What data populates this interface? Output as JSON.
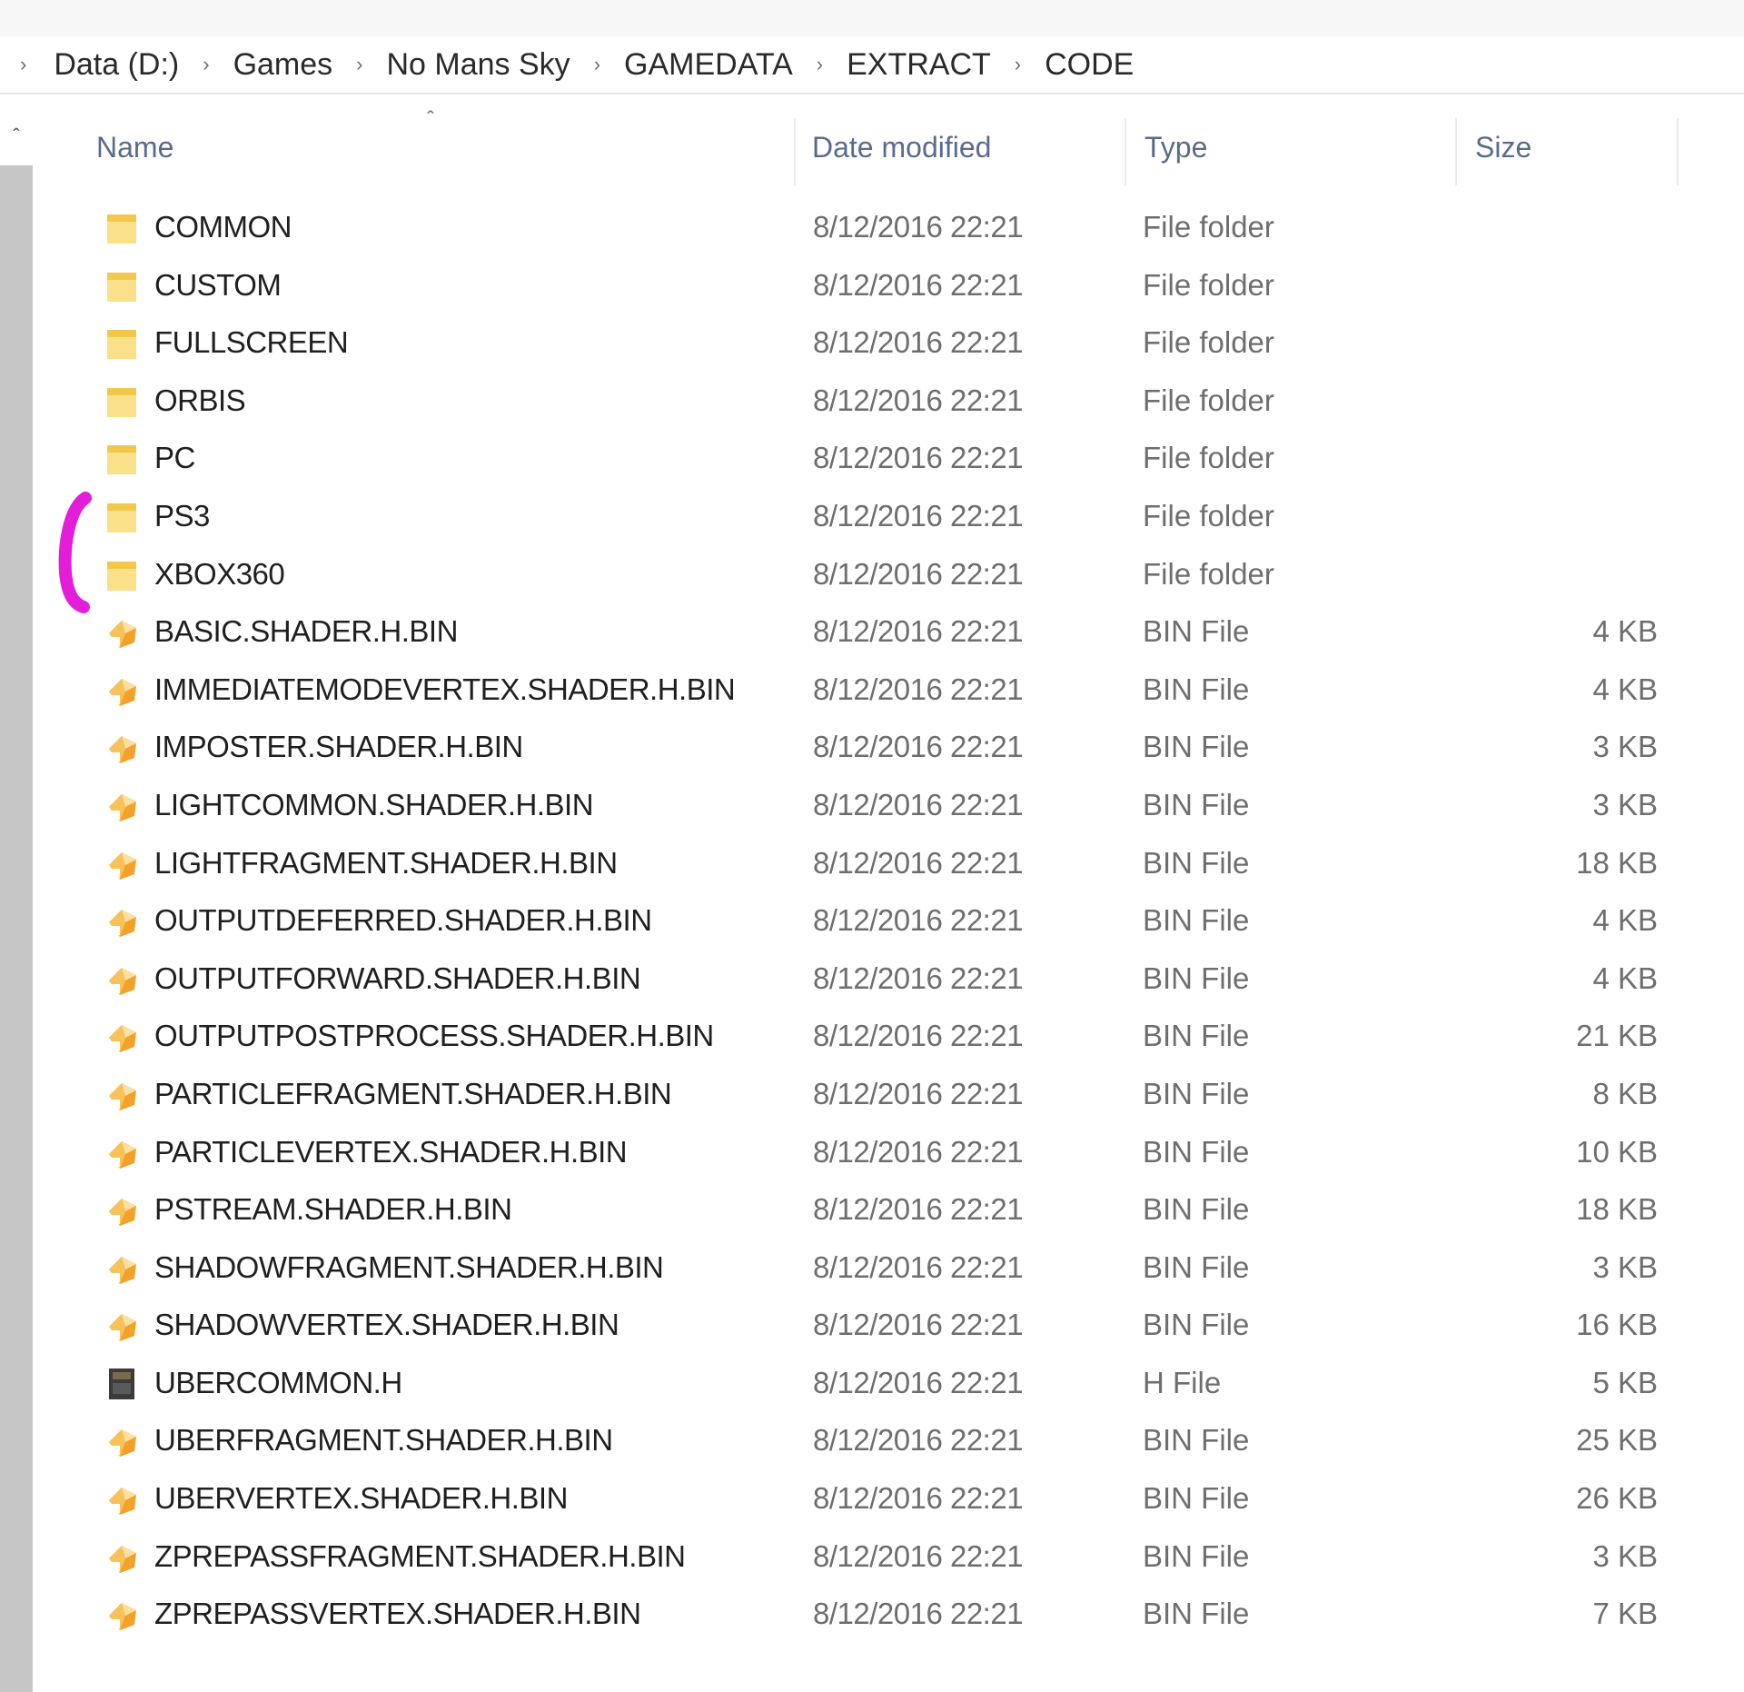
{
  "breadcrumb": {
    "items": [
      "Data (D:)",
      "Games",
      "No Mans Sky",
      "GAMEDATA",
      "EXTRACT",
      "CODE"
    ]
  },
  "columns": {
    "name": "Name",
    "date": "Date modified",
    "type": "Type",
    "size": "Size"
  },
  "icons": {
    "folder": "folder-icon",
    "bin": "bin-file-icon",
    "h": "h-file-icon"
  },
  "colors": {
    "folder": "#f7d66b",
    "bin": "#f2a12a",
    "annotation": "#e21ed8"
  },
  "files": [
    {
      "name": "COMMON",
      "date": "8/12/2016 22:21",
      "type": "File folder",
      "size": "",
      "icon": "folder"
    },
    {
      "name": "CUSTOM",
      "date": "8/12/2016 22:21",
      "type": "File folder",
      "size": "",
      "icon": "folder"
    },
    {
      "name": "FULLSCREEN",
      "date": "8/12/2016 22:21",
      "type": "File folder",
      "size": "",
      "icon": "folder"
    },
    {
      "name": "ORBIS",
      "date": "8/12/2016 22:21",
      "type": "File folder",
      "size": "",
      "icon": "folder"
    },
    {
      "name": "PC",
      "date": "8/12/2016 22:21",
      "type": "File folder",
      "size": "",
      "icon": "folder"
    },
    {
      "name": "PS3",
      "date": "8/12/2016 22:21",
      "type": "File folder",
      "size": "",
      "icon": "folder"
    },
    {
      "name": "XBOX360",
      "date": "8/12/2016 22:21",
      "type": "File folder",
      "size": "",
      "icon": "folder"
    },
    {
      "name": "BASIC.SHADER.H.BIN",
      "date": "8/12/2016 22:21",
      "type": "BIN File",
      "size": "4 KB",
      "icon": "bin"
    },
    {
      "name": "IMMEDIATEMODEVERTEX.SHADER.H.BIN",
      "date": "8/12/2016 22:21",
      "type": "BIN File",
      "size": "4 KB",
      "icon": "bin"
    },
    {
      "name": "IMPOSTER.SHADER.H.BIN",
      "date": "8/12/2016 22:21",
      "type": "BIN File",
      "size": "3 KB",
      "icon": "bin"
    },
    {
      "name": "LIGHTCOMMON.SHADER.H.BIN",
      "date": "8/12/2016 22:21",
      "type": "BIN File",
      "size": "3 KB",
      "icon": "bin"
    },
    {
      "name": "LIGHTFRAGMENT.SHADER.H.BIN",
      "date": "8/12/2016 22:21",
      "type": "BIN File",
      "size": "18 KB",
      "icon": "bin"
    },
    {
      "name": "OUTPUTDEFERRED.SHADER.H.BIN",
      "date": "8/12/2016 22:21",
      "type": "BIN File",
      "size": "4 KB",
      "icon": "bin"
    },
    {
      "name": "OUTPUTFORWARD.SHADER.H.BIN",
      "date": "8/12/2016 22:21",
      "type": "BIN File",
      "size": "4 KB",
      "icon": "bin"
    },
    {
      "name": "OUTPUTPOSTPROCESS.SHADER.H.BIN",
      "date": "8/12/2016 22:21",
      "type": "BIN File",
      "size": "21 KB",
      "icon": "bin"
    },
    {
      "name": "PARTICLEFRAGMENT.SHADER.H.BIN",
      "date": "8/12/2016 22:21",
      "type": "BIN File",
      "size": "8 KB",
      "icon": "bin"
    },
    {
      "name": "PARTICLEVERTEX.SHADER.H.BIN",
      "date": "8/12/2016 22:21",
      "type": "BIN File",
      "size": "10 KB",
      "icon": "bin"
    },
    {
      "name": "PSTREAM.SHADER.H.BIN",
      "date": "8/12/2016 22:21",
      "type": "BIN File",
      "size": "18 KB",
      "icon": "bin"
    },
    {
      "name": "SHADOWFRAGMENT.SHADER.H.BIN",
      "date": "8/12/2016 22:21",
      "type": "BIN File",
      "size": "3 KB",
      "icon": "bin"
    },
    {
      "name": "SHADOWVERTEX.SHADER.H.BIN",
      "date": "8/12/2016 22:21",
      "type": "BIN File",
      "size": "16 KB",
      "icon": "bin"
    },
    {
      "name": "UBERCOMMON.H",
      "date": "8/12/2016 22:21",
      "type": "H File",
      "size": "5 KB",
      "icon": "h"
    },
    {
      "name": "UBERFRAGMENT.SHADER.H.BIN",
      "date": "8/12/2016 22:21",
      "type": "BIN File",
      "size": "25 KB",
      "icon": "bin"
    },
    {
      "name": "UBERVERTEX.SHADER.H.BIN",
      "date": "8/12/2016 22:21",
      "type": "BIN File",
      "size": "26 KB",
      "icon": "bin"
    },
    {
      "name": "ZPREPASSFRAGMENT.SHADER.H.BIN",
      "date": "8/12/2016 22:21",
      "type": "BIN File",
      "size": "3 KB",
      "icon": "bin"
    },
    {
      "name": "ZPREPASSVERTEX.SHADER.H.BIN",
      "date": "8/12/2016 22:21",
      "type": "BIN File",
      "size": "7 KB",
      "icon": "bin"
    }
  ]
}
